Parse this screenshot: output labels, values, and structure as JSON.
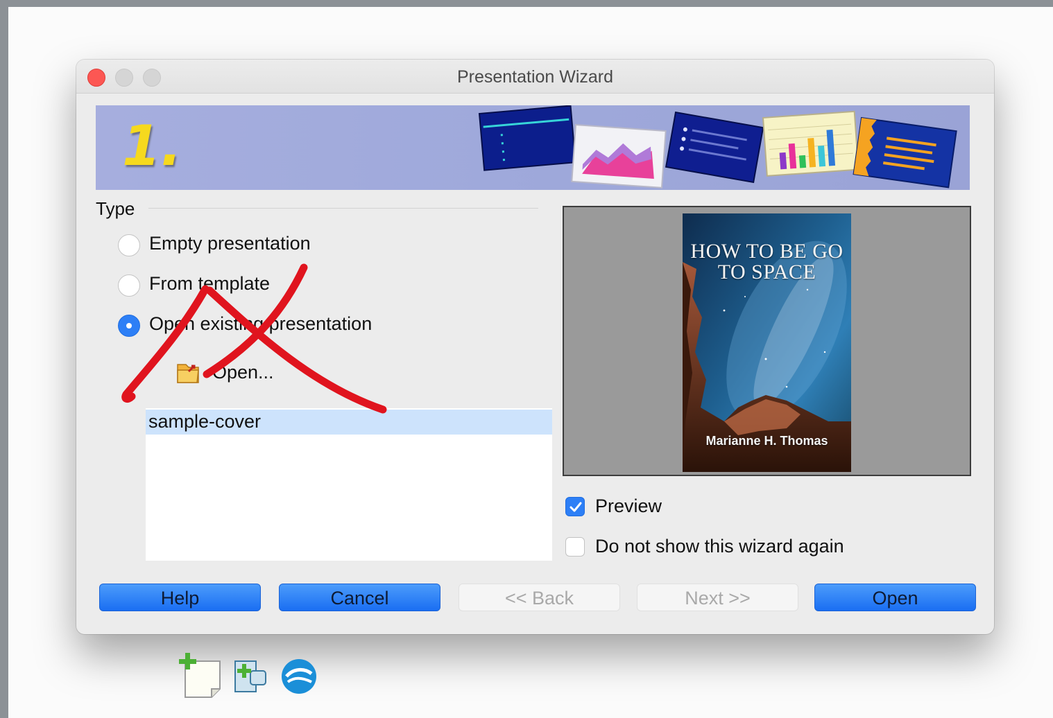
{
  "window": {
    "title": "Presentation Wizard"
  },
  "banner": {
    "step": "1."
  },
  "type_section": {
    "label": "Type",
    "options": [
      {
        "label": "Empty presentation",
        "selected": false
      },
      {
        "label": "From template",
        "selected": false
      },
      {
        "label": "Open existing presentation",
        "selected": true
      }
    ],
    "open_link": "Open...",
    "files": [
      "sample-cover"
    ],
    "selected_file": "sample-cover"
  },
  "preview": {
    "cover_title_line1": "HOW TO BE GO",
    "cover_title_line2": "TO SPACE",
    "cover_author": "Marianne H. Thomas",
    "preview_label": "Preview",
    "preview_checked": true,
    "no_show_label": "Do not show this wizard again",
    "no_show_checked": false
  },
  "buttons": {
    "help": "Help",
    "cancel": "Cancel",
    "back": "<< Back",
    "next": "Next >>",
    "open": "Open"
  },
  "colors": {
    "accent": "#2d7ff6",
    "annotation_cross": "#e0141e",
    "banner_bg": "#a2abdc",
    "list_selection": "#cde3fc"
  }
}
